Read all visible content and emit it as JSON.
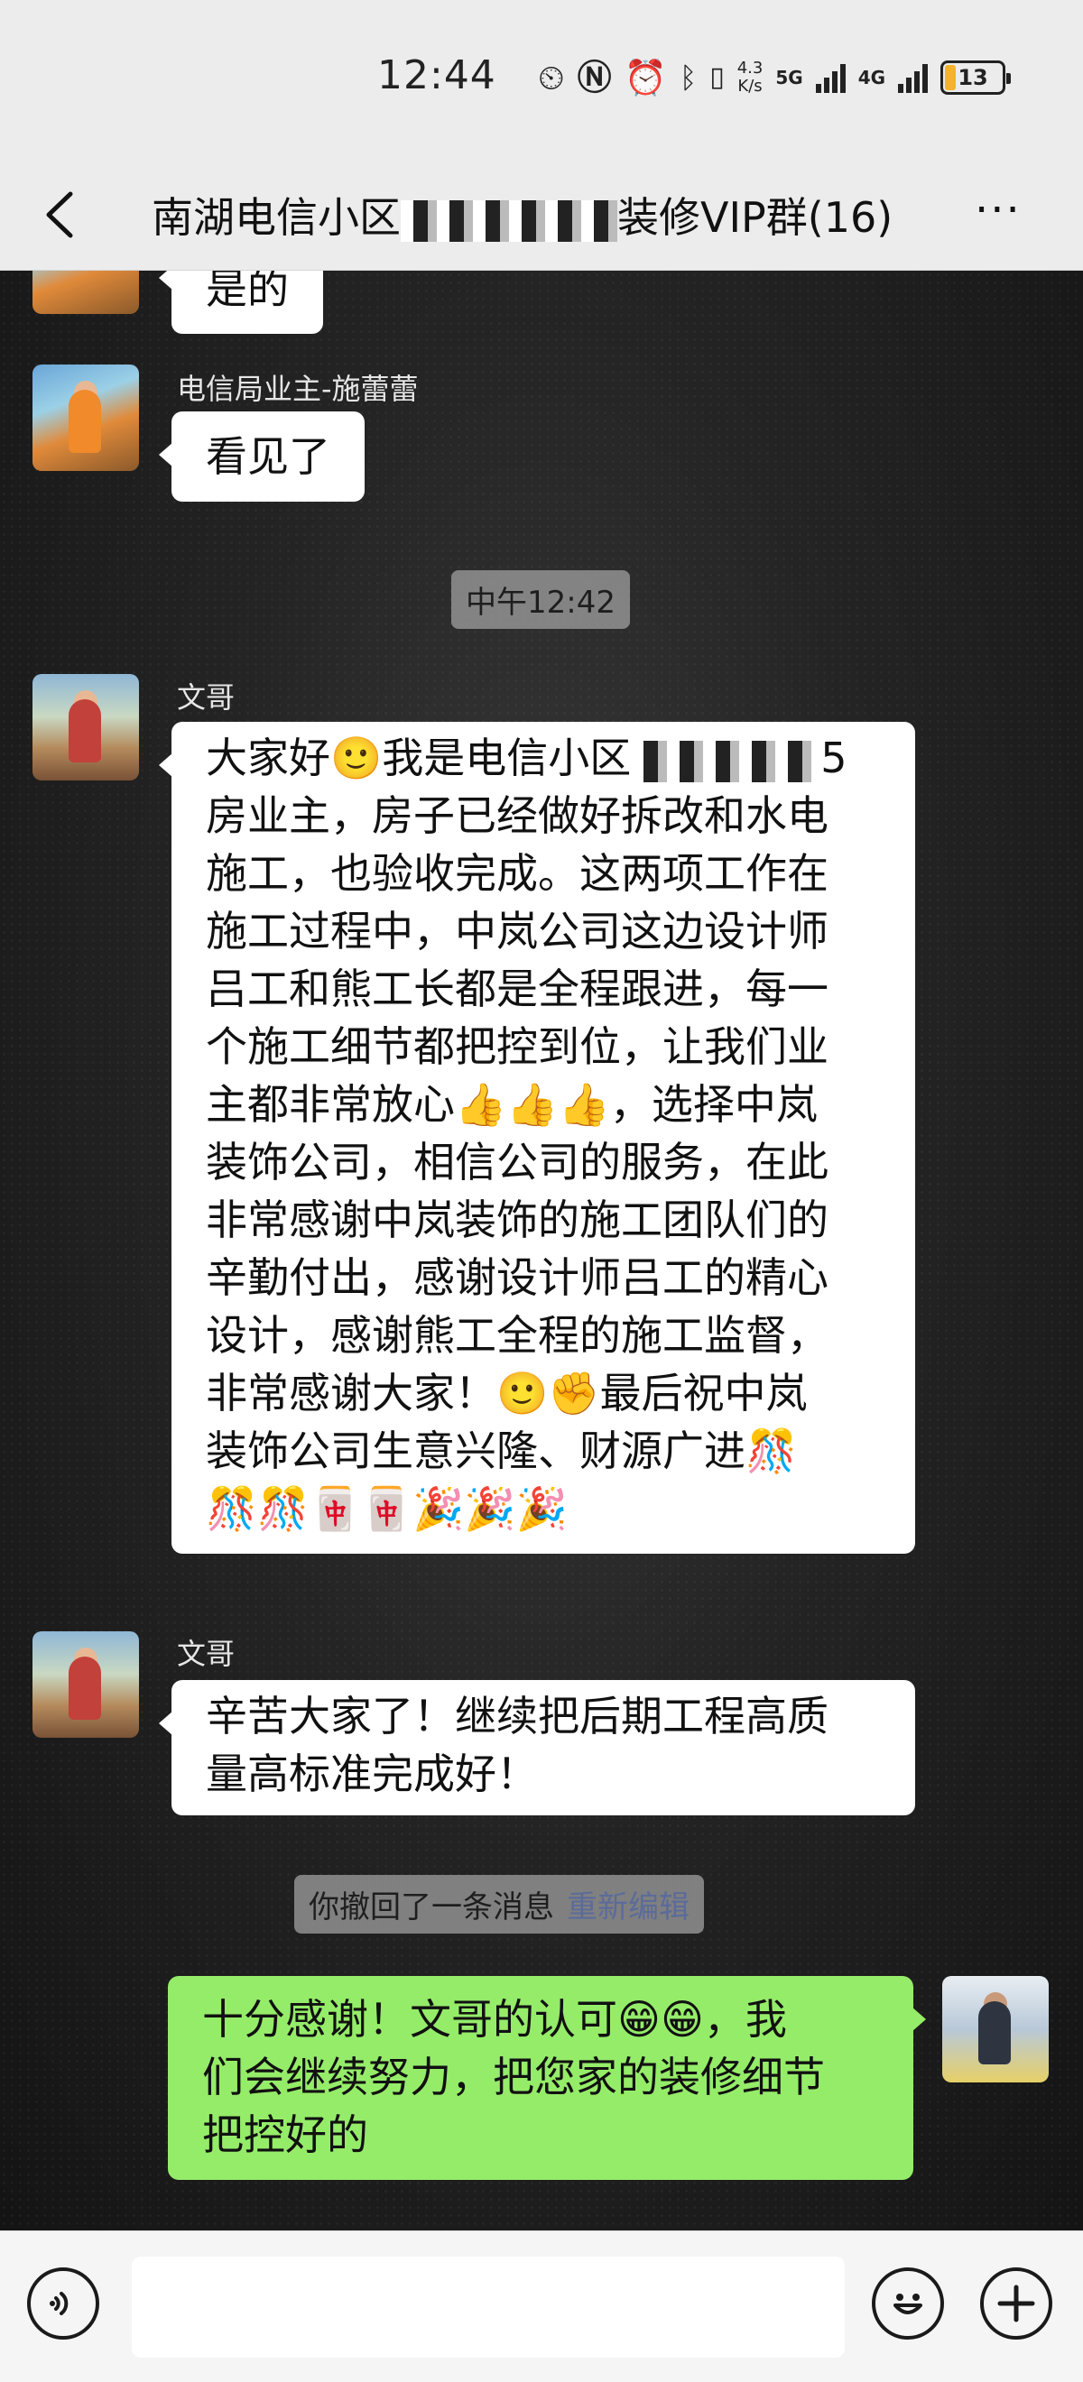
{
  "status_bar": {
    "time": "12:44",
    "speed_top": "4.3",
    "speed_bottom": "K/s",
    "network1": "5G",
    "network2": "4G",
    "battery": "13"
  },
  "header": {
    "title": "南湖电信小区",
    "title_suffix": "装修VIP群(16)",
    "more": "···"
  },
  "messages": {
    "partial_top": "是的",
    "sender1": "电信局业主-施蕾蕾",
    "msg1": "看见了",
    "timestamp": "中午12:42",
    "sender2": "文哥",
    "msg2_lines": [
      "大家好🙂我是电信小区",
      "房业主，房子已经做好拆改和水电",
      "施工，也验收完成。这两项工作在",
      "施工过程中，中岚公司这边设计师",
      "吕工和熊工长都是全程跟进，每一",
      "个施工细节都把控到位，让我们业",
      "主都非常放心👍👍👍，选择中岚",
      "装饰公司，相信公司的服务，在此",
      "非常感谢中岚装饰的施工团队们的",
      "辛勤付出，感谢设计师吕工的精心",
      "设计，感谢熊工全程的施工监督，",
      "非常感谢大家！🙂✊最后祝中岚",
      "装饰公司生意兴隆、财源广进🎊",
      "🎊🎊🀄🀄🎉🎉🎉"
    ],
    "msg2_suffix": "5",
    "sender3": "文哥",
    "msg3_lines": [
      "辛苦大家了！继续把后期工程高质",
      "量高标准完成好！"
    ],
    "recall_text": "你撤回了一条消息",
    "reedit_text": "重新编辑",
    "msg4_lines": [
      "十分感谢！文哥的认可😁😁，我",
      "们会继续努力，把您家的装修细节",
      "把控好的"
    ]
  },
  "input": {
    "voice_icon": "voice-icon",
    "emoji_icon": "emoji-icon",
    "plus_icon": "plus-icon"
  }
}
